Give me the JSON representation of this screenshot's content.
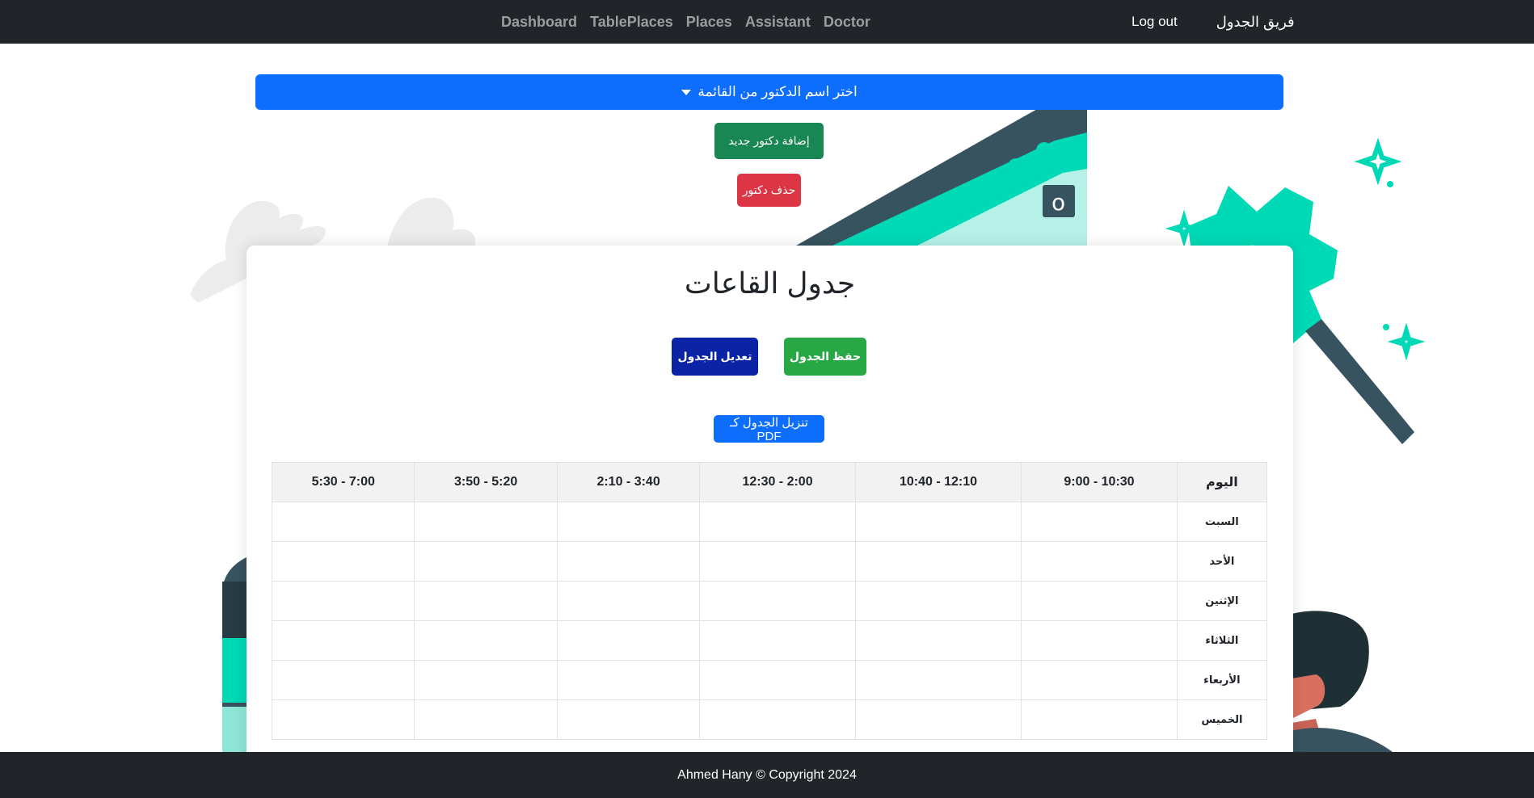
{
  "navbar": {
    "links": [
      "Dashboard",
      "TablePlaces",
      "Places",
      "Assistant",
      "Doctor"
    ],
    "logout": "Log out",
    "brand": "فريق الجدول"
  },
  "doctor_select": {
    "label": "اختر اسم الدكتور من القائمة"
  },
  "buttons": {
    "add_doctor": "إضافة دكتور جديد",
    "delete_doctor": "حذف دكتور",
    "save_table": "حفظ الجدول",
    "edit_table": "تعديل الجدول",
    "download_pdf": "تنزيل الجدول كـ PDF"
  },
  "card": {
    "title": "جدول القاعات"
  },
  "schedule": {
    "headers": [
      "اليوم",
      "9:00 - 10:30",
      "10:40 - 12:10",
      "12:30 - 2:00",
      "2:10 - 3:40",
      "3:50 - 5:20",
      "5:30 - 7:00"
    ],
    "days": [
      "السبت",
      "الأحد",
      "الإثنين",
      "الثلاثاء",
      "الأربعاء",
      "الخميس"
    ]
  },
  "footer": {
    "text": "Ahmed Hany © Copyright 2024"
  },
  "colors": {
    "navbar": "#212529",
    "primary": "#0d6efd",
    "success": "#198754",
    "save": "#28a745",
    "danger": "#dc3545",
    "edit": "#0b24a6",
    "accent_teal": "#00d9b5",
    "dark_slate": "#37535f"
  }
}
